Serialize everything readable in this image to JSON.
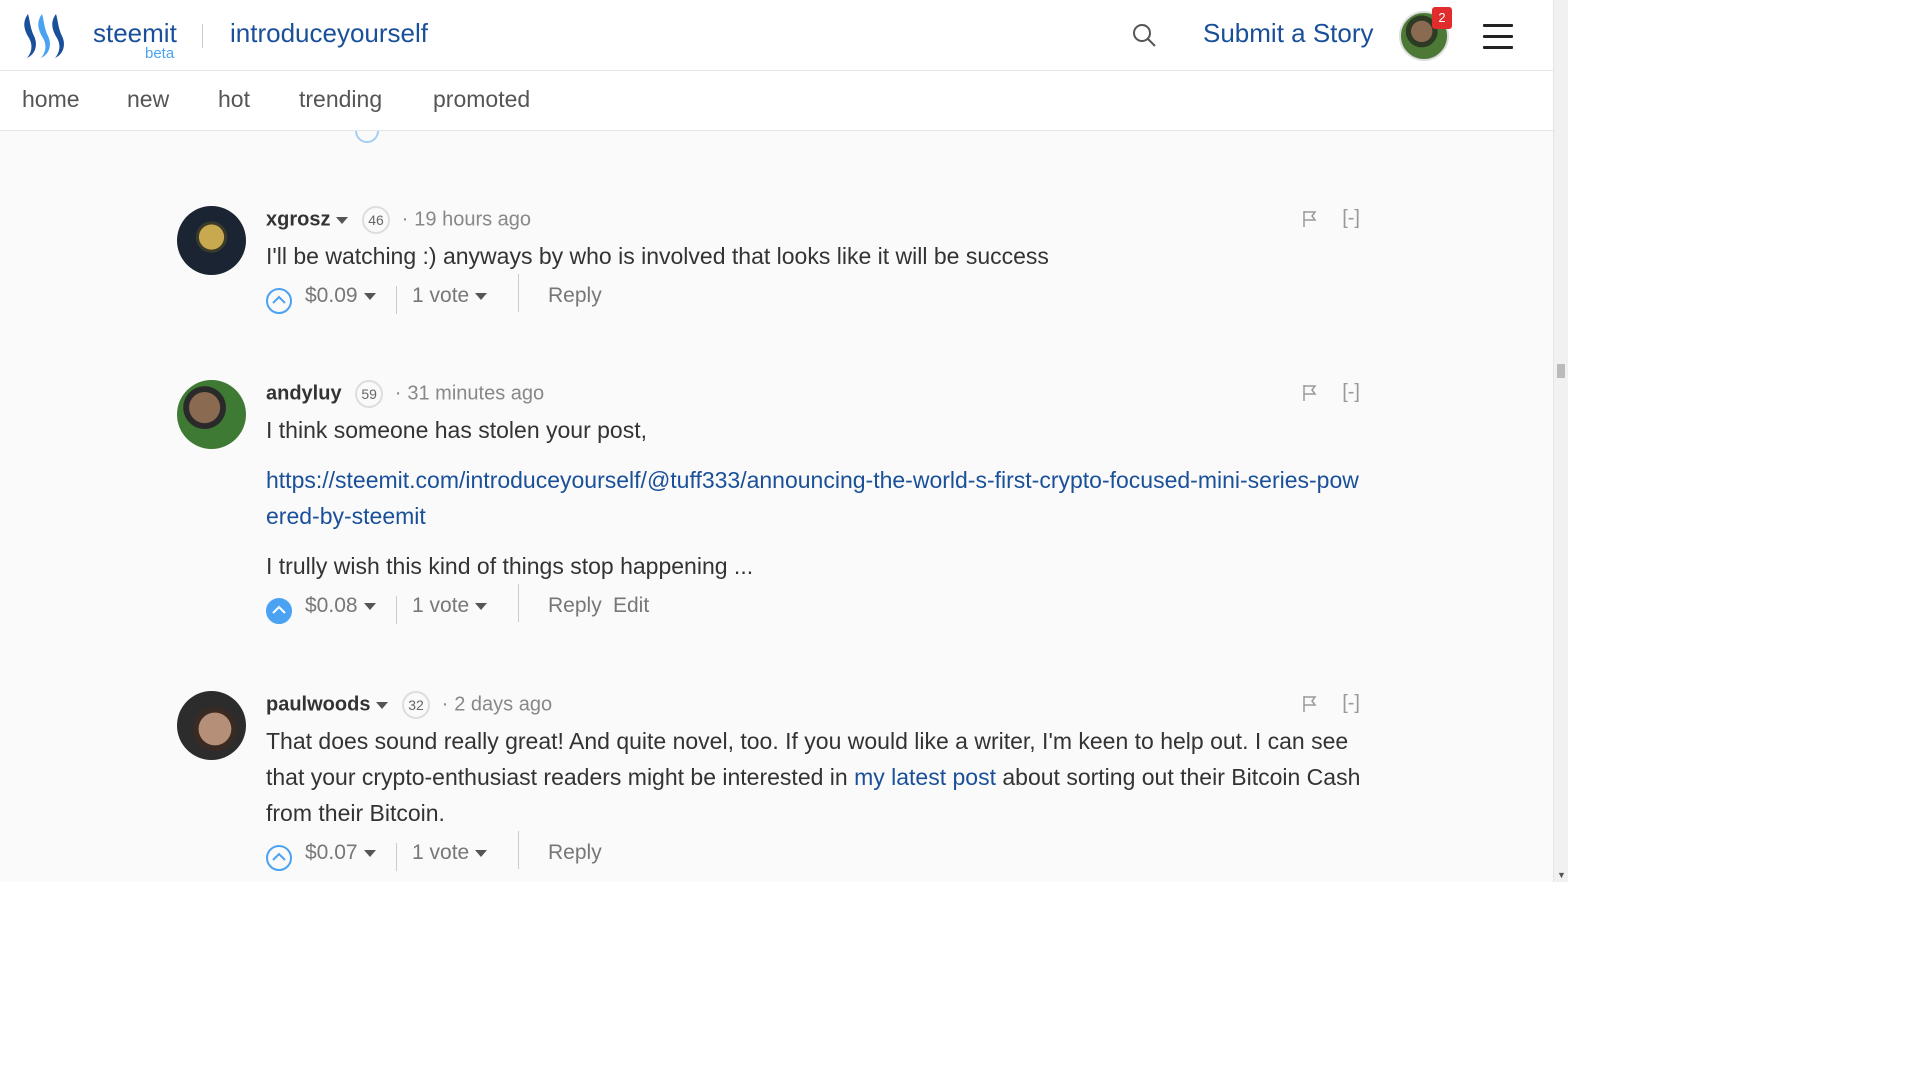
{
  "header": {
    "brand": "steemit",
    "beta": "beta",
    "tag": "introduceyourself",
    "submit": "Submit a Story",
    "notifications": "2"
  },
  "subnav": [
    "home",
    "new",
    "hot",
    "trending",
    "promoted"
  ],
  "comments": [
    {
      "author": "xgrosz",
      "rep": "46",
      "time": "19 hours ago",
      "text": "I'll be watching :) anyways by who is involved that looks like it will be success",
      "payout": "$0.09",
      "votes": "1 vote",
      "reply": "Reply",
      "collapse": "[-]"
    },
    {
      "author": "andyluy",
      "rep": "59",
      "time": "31 minutes ago",
      "text": "I think someone has stolen your post,",
      "link": "https://steemit.com/introduceyourself/@tuff333/announcing-the-world-s-first-crypto-focused-mini-series-powered-by-steemit",
      "text2": "I trully wish this kind of things stop happening ...",
      "payout": "$0.08",
      "votes": "1 vote",
      "reply": "Reply",
      "edit": "Edit",
      "collapse": "[-]"
    },
    {
      "author": "paulwoods",
      "rep": "32",
      "time": "2 days ago",
      "text_before": "That does sound really great! And quite novel, too. If you would like a writer, I'm keen to help out. I can see that your crypto-enthusiast readers might be interested in ",
      "link_text": "my latest post",
      "text_after": " about sorting out their Bitcoin Cash from their Bitcoin.",
      "payout": "$0.07",
      "votes": "1 vote",
      "reply": "Reply",
      "collapse": "[-]"
    }
  ],
  "colors": {
    "brand": "#1a5099",
    "accent": "#4ba2f2",
    "badge": "#e02c2c"
  }
}
